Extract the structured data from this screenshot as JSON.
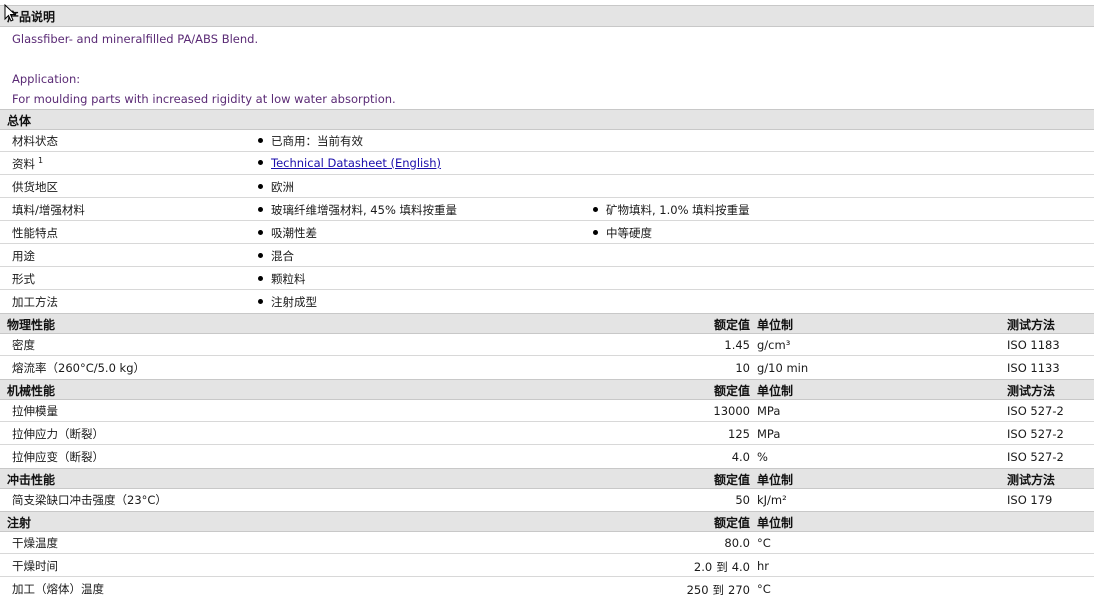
{
  "description": {
    "title": "产品说明",
    "line1": "Glassfiber- and mineralfilled PA/ABS Blend.",
    "line2": "Application:",
    "line3": "For moulding parts with increased rigidity at low water absorption."
  },
  "general": {
    "title": "总体",
    "rows": [
      {
        "label": "材料状态",
        "b1": "已商用：当前有效"
      },
      {
        "label": "资料",
        "sup": "1",
        "b1": "Technical Datasheet (English)"
      },
      {
        "label": "供货地区",
        "b1": "欧洲"
      },
      {
        "label": "填料/增强材料",
        "b1": "玻璃纤维增强材料, 45% 填料按重量",
        "b2": "矿物填料, 1.0% 填料按重量"
      },
      {
        "label": "性能特点",
        "b1": "吸潮性差",
        "b2": "中等硬度"
      },
      {
        "label": "用途",
        "b1": "混合"
      },
      {
        "label": "形式",
        "b1": "颗粒料"
      },
      {
        "label": "加工方法",
        "b1": "注射成型"
      }
    ]
  },
  "columns": {
    "value": "额定值",
    "unit": "单位制",
    "method": "测试方法"
  },
  "physical": {
    "title": "物理性能",
    "rows": [
      {
        "label": "密度",
        "value": "1.45",
        "unit": "g/cm³",
        "method": "ISO 1183"
      },
      {
        "label": "熔流率（260°C/5.0 kg）",
        "value": "10",
        "unit": "g/10 min",
        "method": "ISO 1133"
      }
    ]
  },
  "mechanical": {
    "title": "机械性能",
    "rows": [
      {
        "label": "拉伸模量",
        "value": "13000",
        "unit": "MPa",
        "method": "ISO 527-2"
      },
      {
        "label": "拉伸应力（断裂）",
        "value": "125",
        "unit": "MPa",
        "method": "ISO 527-2"
      },
      {
        "label": "拉伸应变（断裂）",
        "value": "4.0",
        "unit": "%",
        "method": "ISO 527-2"
      }
    ]
  },
  "impact": {
    "title": "冲击性能",
    "rows": [
      {
        "label": "简支梁缺口冲击强度（23°C）",
        "value": "50",
        "unit": "kJ/m²",
        "method": "ISO 179"
      }
    ]
  },
  "injection": {
    "title": "注射",
    "to_word": "到",
    "rows": [
      {
        "label": "干燥温度",
        "value": "80.0",
        "unit": "°C"
      },
      {
        "label": "干燥时间",
        "value_from": "2.0",
        "value_to": "4.0",
        "unit": "hr"
      },
      {
        "label": "加工（熔体）温度",
        "value_from": "250",
        "value_to": "270",
        "unit": "°C"
      }
    ]
  }
}
